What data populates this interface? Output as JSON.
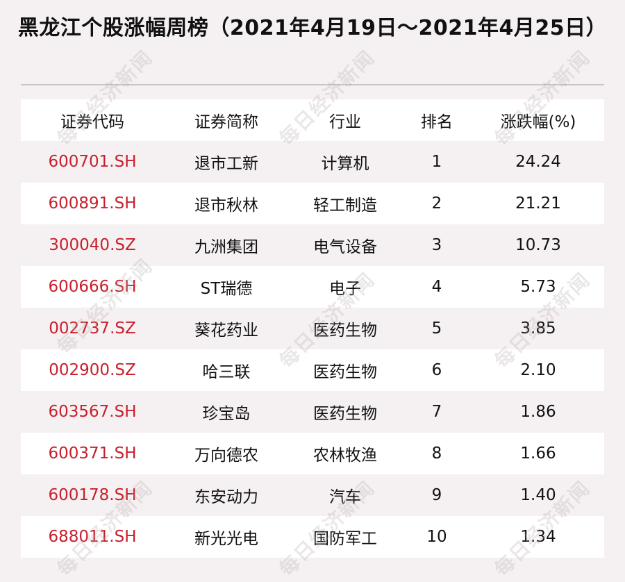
{
  "title": "黑龙江个股涨幅周榜（2021年4月19日～2021年4月25日）",
  "watermark": "每日经济新闻",
  "table": {
    "headers": [
      "证券代码",
      "证券简称",
      "行业",
      "排名",
      "涨跌幅(%)"
    ],
    "rows": [
      {
        "code": "600701.SH",
        "name": "退市工新",
        "industry": "计算机",
        "rank": "1",
        "change": "24.24"
      },
      {
        "code": "600891.SH",
        "name": "退市秋林",
        "industry": "轻工制造",
        "rank": "2",
        "change": "21.21"
      },
      {
        "code": "300040.SZ",
        "name": "九洲集团",
        "industry": "电气设备",
        "rank": "3",
        "change": "10.73"
      },
      {
        "code": "600666.SH",
        "name": "ST瑞德",
        "industry": "电子",
        "rank": "4",
        "change": "5.73"
      },
      {
        "code": "002737.SZ",
        "name": "葵花药业",
        "industry": "医药生物",
        "rank": "5",
        "change": "3.85"
      },
      {
        "code": "002900.SZ",
        "name": "哈三联",
        "industry": "医药生物",
        "rank": "6",
        "change": "2.10"
      },
      {
        "code": "603567.SH",
        "name": "珍宝岛",
        "industry": "医药生物",
        "rank": "7",
        "change": "1.86"
      },
      {
        "code": "600371.SH",
        "name": "万向德农",
        "industry": "农林牧渔",
        "rank": "8",
        "change": "1.66"
      },
      {
        "code": "600178.SH",
        "name": "东安动力",
        "industry": "汽车",
        "rank": "9",
        "change": "1.40"
      },
      {
        "code": "688011.SH",
        "name": "新光光电",
        "industry": "国防军工",
        "rank": "10",
        "change": "1.34"
      }
    ]
  },
  "colors": {
    "code_red": "#c8202c",
    "background": "#f5f1f2",
    "row_alt": "#ffffff"
  }
}
